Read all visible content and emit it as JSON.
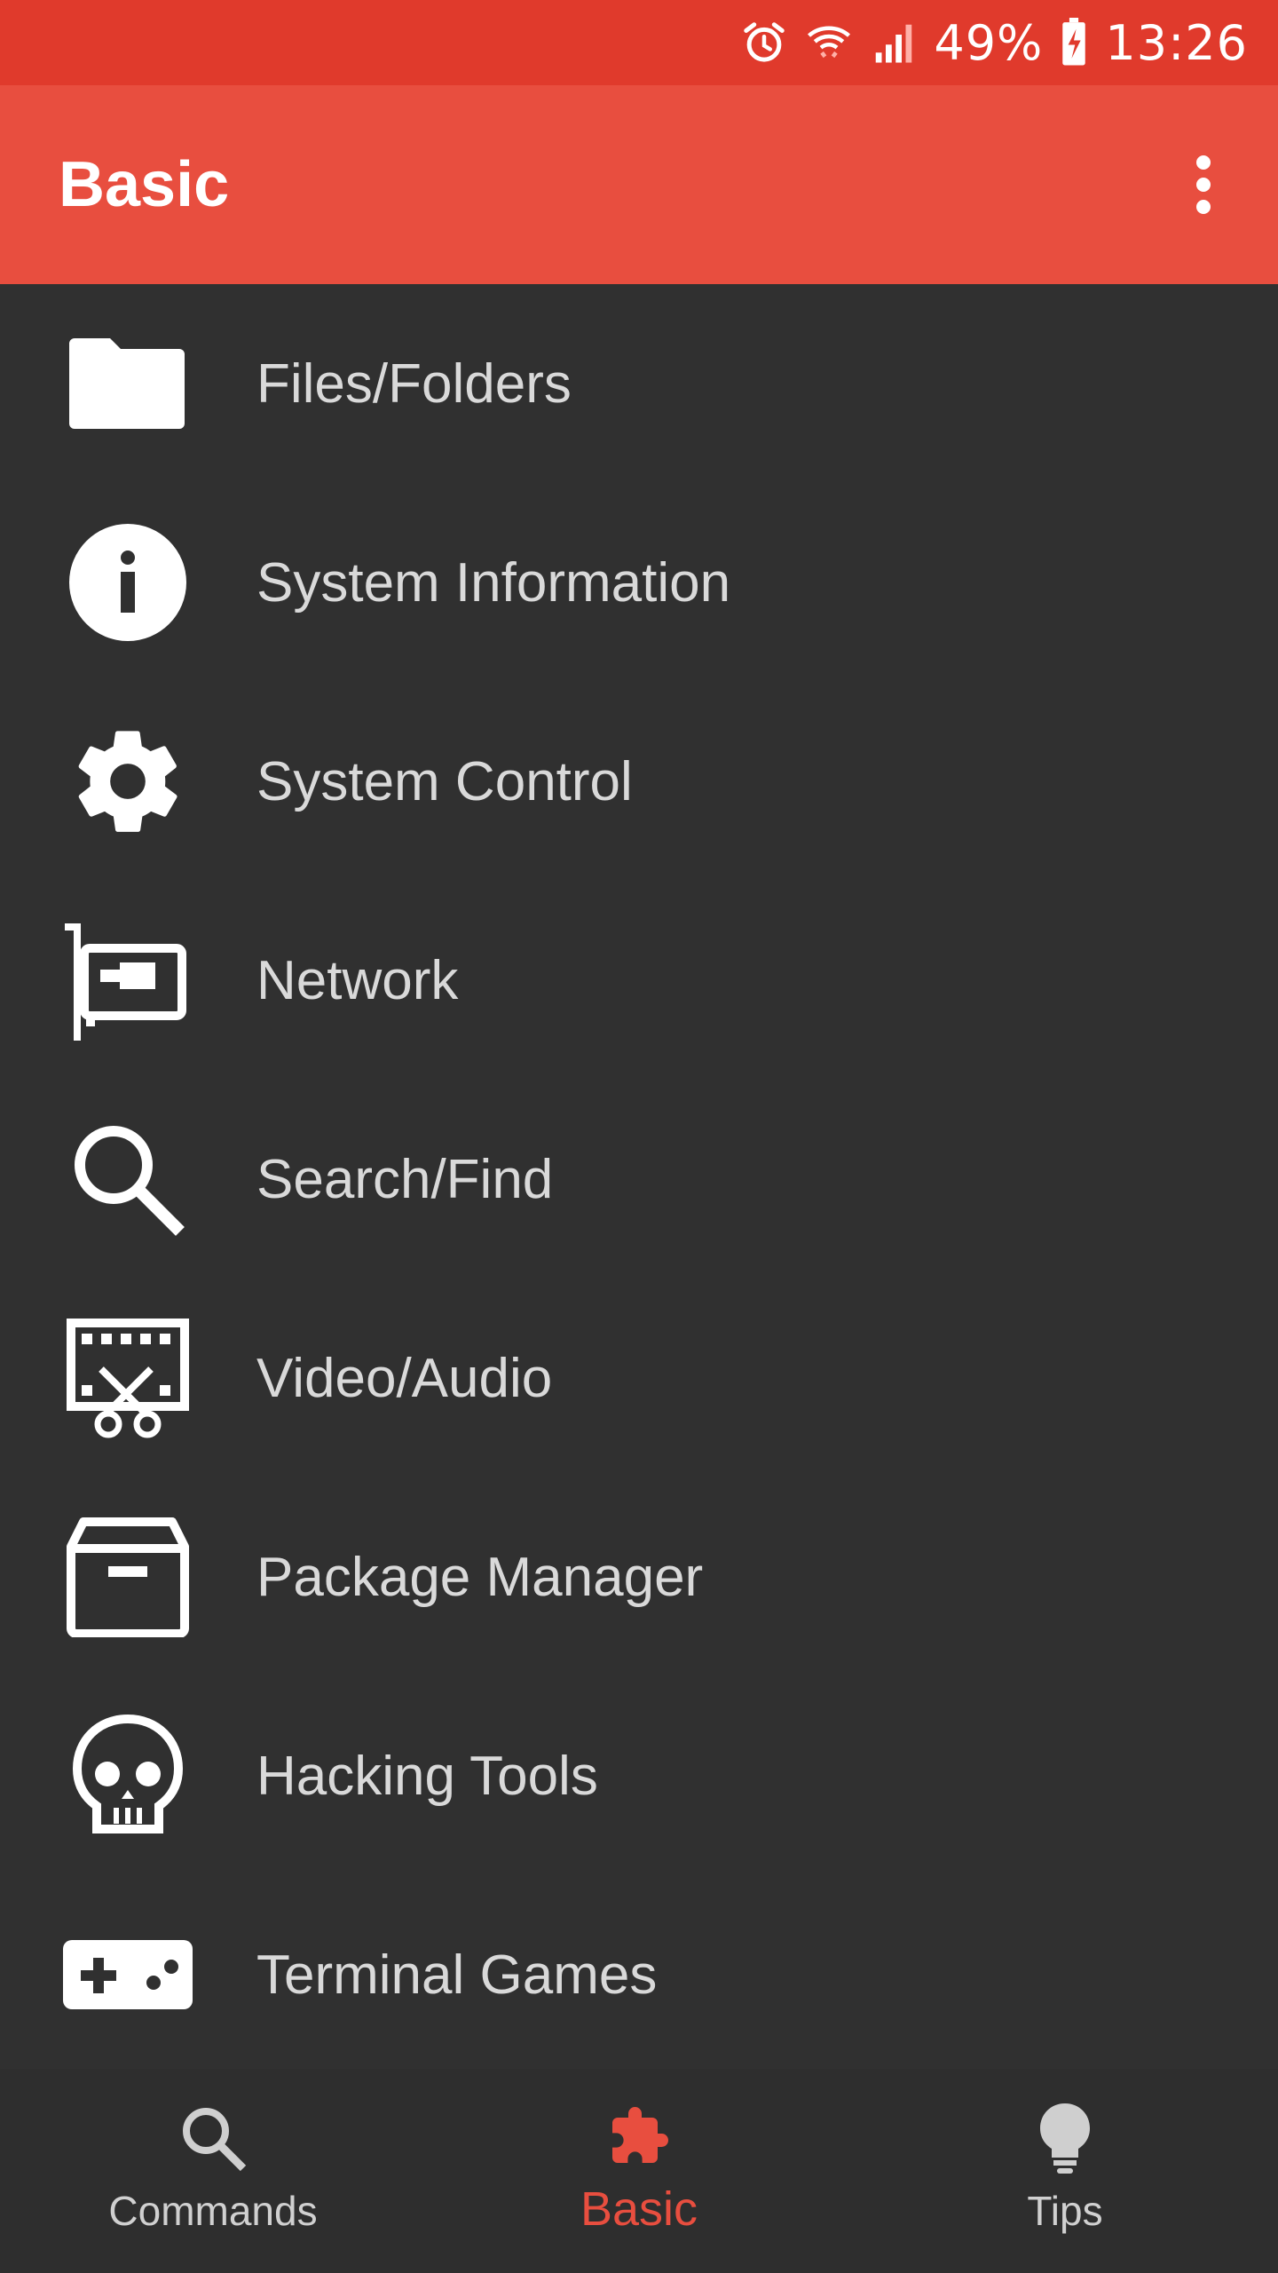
{
  "status_bar": {
    "battery_percent": "49%",
    "time": "13:26",
    "icons": [
      "alarm-icon",
      "wifi-icon",
      "signal-icon",
      "battery-charging-icon"
    ]
  },
  "app_bar": {
    "title": "Basic",
    "menu_icon": "more-vert-icon",
    "background": "#e84e3f"
  },
  "list": {
    "items": [
      {
        "label": "Files/Folders",
        "icon": "folder-icon"
      },
      {
        "label": "System Information",
        "icon": "info-icon"
      },
      {
        "label": "System Control",
        "icon": "gear-icon"
      },
      {
        "label": "Network",
        "icon": "network-card-icon"
      },
      {
        "label": "Search/Find",
        "icon": "search-icon"
      },
      {
        "label": "Video/Audio",
        "icon": "video-cut-icon"
      },
      {
        "label": "Package Manager",
        "icon": "package-icon"
      },
      {
        "label": "Hacking Tools",
        "icon": "skull-icon"
      },
      {
        "label": "Terminal Games",
        "icon": "gamepad-icon"
      }
    ]
  },
  "bottom_nav": {
    "items": [
      {
        "label": "Commands",
        "icon": "search-icon",
        "active": false
      },
      {
        "label": "Basic",
        "icon": "puzzle-icon",
        "active": true
      },
      {
        "label": "Tips",
        "icon": "lightbulb-icon",
        "active": false
      }
    ],
    "active_color": "#e84e3f"
  }
}
